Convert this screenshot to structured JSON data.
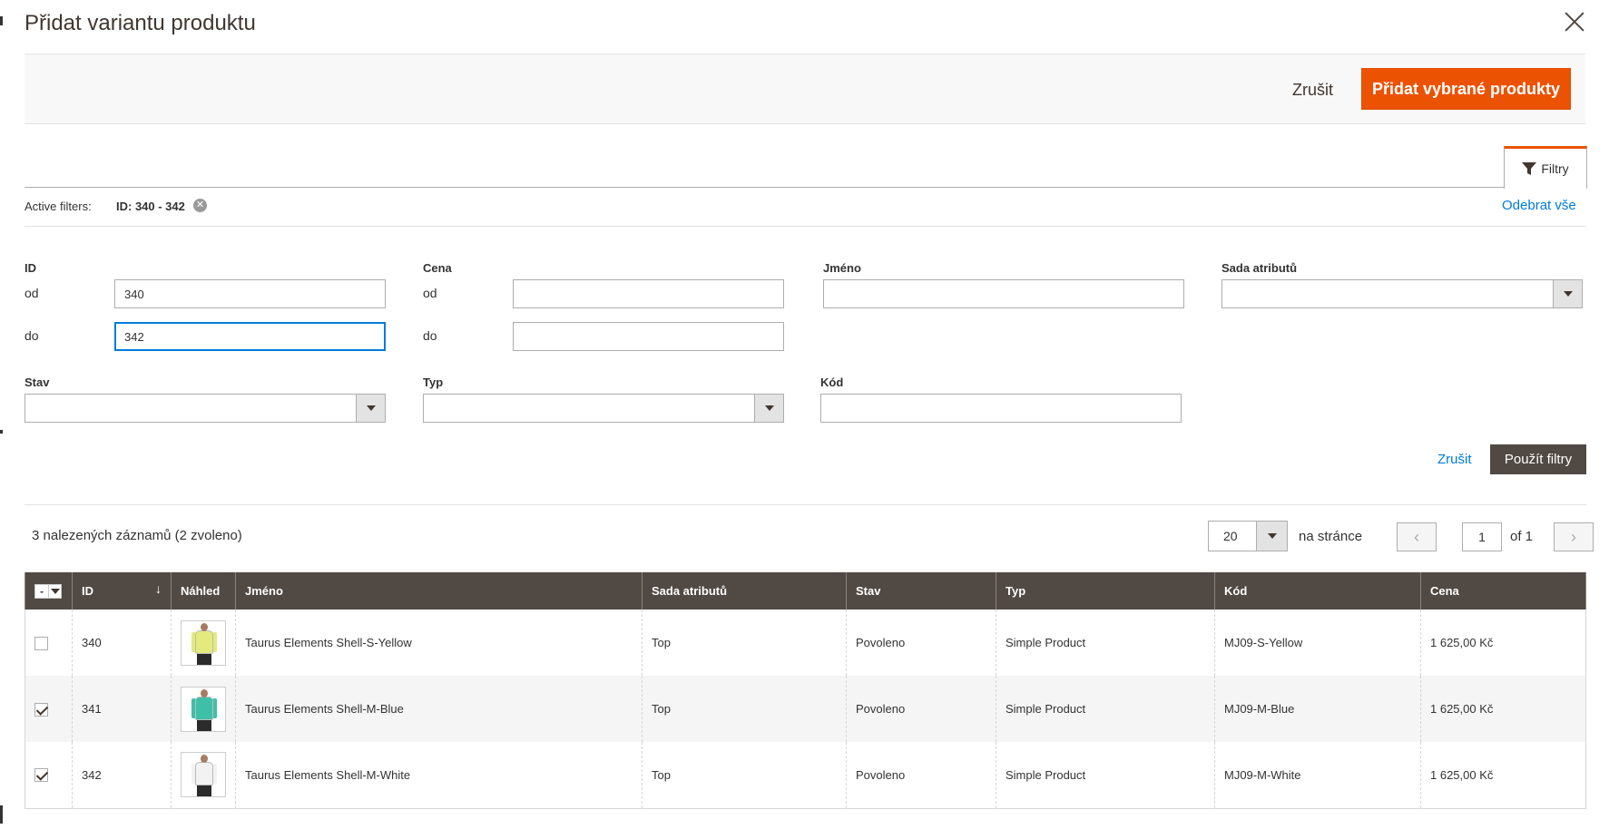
{
  "modal": {
    "title": "Přidat variantu produktu",
    "cancel_label": "Zrušit",
    "primary_label": "Přidat vybrané produkty"
  },
  "filters": {
    "tab_label": "Filtry",
    "active_label": "Active filters:",
    "active_chip": "ID: 340 - 342",
    "clear_all": "Odebrat vše",
    "id_label": "ID",
    "price_label": "Cena",
    "name_label": "Jméno",
    "attrset_label": "Sada atributů",
    "status_label": "Stav",
    "type_label": "Typ",
    "sku_label": "Kód",
    "from_label": "od",
    "to_label": "do",
    "id_from": "340",
    "id_to": "342",
    "price_from": "",
    "price_to": "",
    "name_value": "",
    "sku_value": "",
    "cancel_label": "Zrušit",
    "apply_label": "Použít filtry"
  },
  "grid": {
    "records_text": "3 nalezených záznamů (2 zvoleno)",
    "per_page": "20",
    "per_page_label": "na stránce",
    "page": "1",
    "of_pages": "of 1",
    "mass_action": "-",
    "columns": [
      "ID",
      "Náhled",
      "Jméno",
      "Sada atributů",
      "Stav",
      "Typ",
      "Kód",
      "Cena"
    ],
    "rows": [
      {
        "checked": false,
        "id": "340",
        "thumb_color": "#e4ea7d",
        "name": "Taurus Elements Shell-S-Yellow",
        "attrset": "Top",
        "status": "Povoleno",
        "type": "Simple Product",
        "sku": "MJ09-S-Yellow",
        "price": "1 625,00 Kč"
      },
      {
        "checked": true,
        "id": "341",
        "thumb_color": "#3ec0a8",
        "name": "Taurus Elements Shell-M-Blue",
        "attrset": "Top",
        "status": "Povoleno",
        "type": "Simple Product",
        "sku": "MJ09-M-Blue",
        "price": "1 625,00 Kč"
      },
      {
        "checked": true,
        "id": "342",
        "thumb_color": "#f2f2f2",
        "name": "Taurus Elements Shell-M-White",
        "attrset": "Top",
        "status": "Povoleno",
        "type": "Simple Product",
        "sku": "MJ09-M-White",
        "price": "1 625,00 Kč"
      }
    ]
  },
  "colors": {
    "accent": "#eb5202",
    "header_bg": "#514943",
    "link": "#007bdb"
  }
}
